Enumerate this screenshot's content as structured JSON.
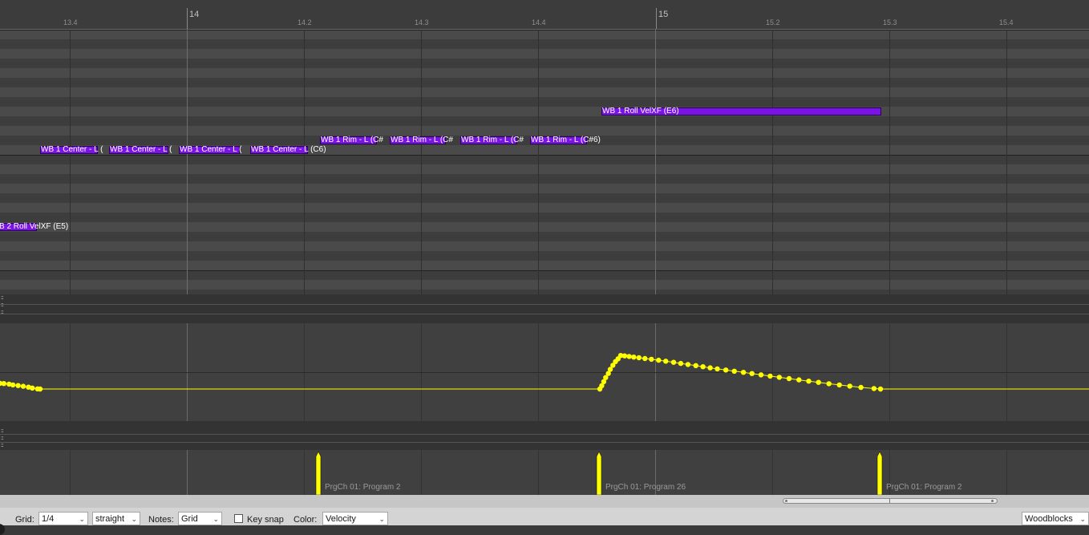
{
  "ruler": {
    "ticks": [
      {
        "label": "13.4",
        "major": false
      },
      {
        "label": "14",
        "major": true
      },
      {
        "label": "14.2",
        "major": false
      },
      {
        "label": "14.3",
        "major": false
      },
      {
        "label": "14.4",
        "major": false
      },
      {
        "label": "15",
        "major": true
      },
      {
        "label": "15.2",
        "major": false
      },
      {
        "label": "15.3",
        "major": false
      },
      {
        "label": "15.4",
        "major": false
      }
    ]
  },
  "notes": [
    {
      "label": "B 2 Roll VelXF (E5)",
      "start": 13.333,
      "end": 13.365,
      "pitch": "E5"
    },
    {
      "label": "WB 1 Center - L (",
      "start": 13.367,
      "end": 13.417,
      "pitch": "C6"
    },
    {
      "label": "WB 1 Center - L (",
      "start": 13.427,
      "end": 13.477,
      "pitch": "C6"
    },
    {
      "label": "WB 1 Center - L (",
      "start": 13.487,
      "end": 13.537,
      "pitch": "C6"
    },
    {
      "label": "WB 1 Center - L (C6)",
      "start": 14.05,
      "end": 14.1,
      "pitch": "C6"
    },
    {
      "label": "WB 1 Rim - L (C#",
      "start": 14.11,
      "end": 14.16,
      "pitch": "C#6"
    },
    {
      "label": "WB 1 Rim - L (C#",
      "start": 14.17,
      "end": 14.22,
      "pitch": "C#6"
    },
    {
      "label": "WB 1 Rim - L (C#",
      "start": 14.23,
      "end": 14.28,
      "pitch": "C#6"
    },
    {
      "label": "WB 1 Rim - L (C#6)",
      "start": 14.29,
      "end": 14.34,
      "pitch": "C#6"
    },
    {
      "label": "WB 1 Roll VelXF (E6)",
      "start": 14.355,
      "end": 15.255,
      "pitch": "E6"
    }
  ],
  "cc_points": [
    {
      "pos": 13.333,
      "value": 0.07
    },
    {
      "pos": 13.336,
      "value": 0.067
    },
    {
      "pos": 13.34,
      "value": 0.06
    },
    {
      "pos": 13.343,
      "value": 0.05
    },
    {
      "pos": 13.347,
      "value": 0.042
    },
    {
      "pos": 13.351,
      "value": 0.033
    },
    {
      "pos": 13.355,
      "value": 0.023
    },
    {
      "pos": 13.358,
      "value": 0.012
    },
    {
      "pos": 13.362,
      "value": 0.002
    },
    {
      "pos": 13.364,
      "value": 0.0
    },
    {
      "pos": 14.355,
      "value": 0.0
    },
    {
      "pos": 14.358,
      "value": 0.04
    },
    {
      "pos": 14.361,
      "value": 0.09
    },
    {
      "pos": 14.364,
      "value": 0.14
    },
    {
      "pos": 14.368,
      "value": 0.19
    },
    {
      "pos": 14.371,
      "value": 0.24
    },
    {
      "pos": 14.375,
      "value": 0.29
    },
    {
      "pos": 14.379,
      "value": 0.335
    },
    {
      "pos": 14.383,
      "value": 0.37
    },
    {
      "pos": 14.387,
      "value": 0.41
    },
    {
      "pos": 14.393,
      "value": 0.405
    },
    {
      "pos": 14.4,
      "value": 0.398
    },
    {
      "pos": 14.407,
      "value": 0.39
    },
    {
      "pos": 14.415,
      "value": 0.382
    },
    {
      "pos": 14.424,
      "value": 0.373
    },
    {
      "pos": 14.434,
      "value": 0.364
    },
    {
      "pos": 14.445,
      "value": 0.352
    },
    {
      "pos": 14.456,
      "value": 0.34
    },
    {
      "pos": 14.468,
      "value": 0.326
    },
    {
      "pos": 14.479,
      "value": 0.313
    },
    {
      "pos": 14.49,
      "value": 0.3
    },
    {
      "pos": 14.502,
      "value": 0.286
    },
    {
      "pos": 14.513,
      "value": 0.273
    },
    {
      "pos": 14.524,
      "value": 0.259
    },
    {
      "pos": 14.535,
      "value": 0.246
    },
    {
      "pos": 14.548,
      "value": 0.232
    },
    {
      "pos": 14.561,
      "value": 0.218
    },
    {
      "pos": 14.575,
      "value": 0.204
    },
    {
      "pos": 14.588,
      "value": 0.189
    },
    {
      "pos": 14.602,
      "value": 0.174
    },
    {
      "pos": 14.616,
      "value": 0.158
    },
    {
      "pos": 14.63,
      "value": 0.143
    },
    {
      "pos": 14.645,
      "value": 0.127
    },
    {
      "pos": 14.66,
      "value": 0.112
    },
    {
      "pos": 14.675,
      "value": 0.096
    },
    {
      "pos": 14.69,
      "value": 0.081
    },
    {
      "pos": 14.706,
      "value": 0.065
    },
    {
      "pos": 14.722,
      "value": 0.05
    },
    {
      "pos": 14.738,
      "value": 0.035
    },
    {
      "pos": 14.755,
      "value": 0.02
    },
    {
      "pos": 14.775,
      "value": 0.006
    },
    {
      "pos": 14.785,
      "value": 0.0
    }
  ],
  "program_changes": [
    {
      "label": "PrgCh 01: Program 2",
      "pos": 14.11
    },
    {
      "label": "PrgCh 01: Program 26",
      "pos": 14.355
    },
    {
      "label": "PrgCh 01: Program 2",
      "pos": 14.785
    }
  ],
  "colors": {
    "note": "#7a14e6",
    "cc": "#ffff00",
    "pc_marker": "#ffff00"
  },
  "toolbar": {
    "grid_label": "Grid:",
    "grid_value": "1/4",
    "grid_mode": "straight",
    "notes_label": "Notes:",
    "notes_value": "Grid",
    "keysnap_label": "Key snap",
    "color_label": "Color:",
    "color_value": "Velocity",
    "track_value": "Woodblocks"
  },
  "lane_handles": {
    "glyph": "::::"
  }
}
